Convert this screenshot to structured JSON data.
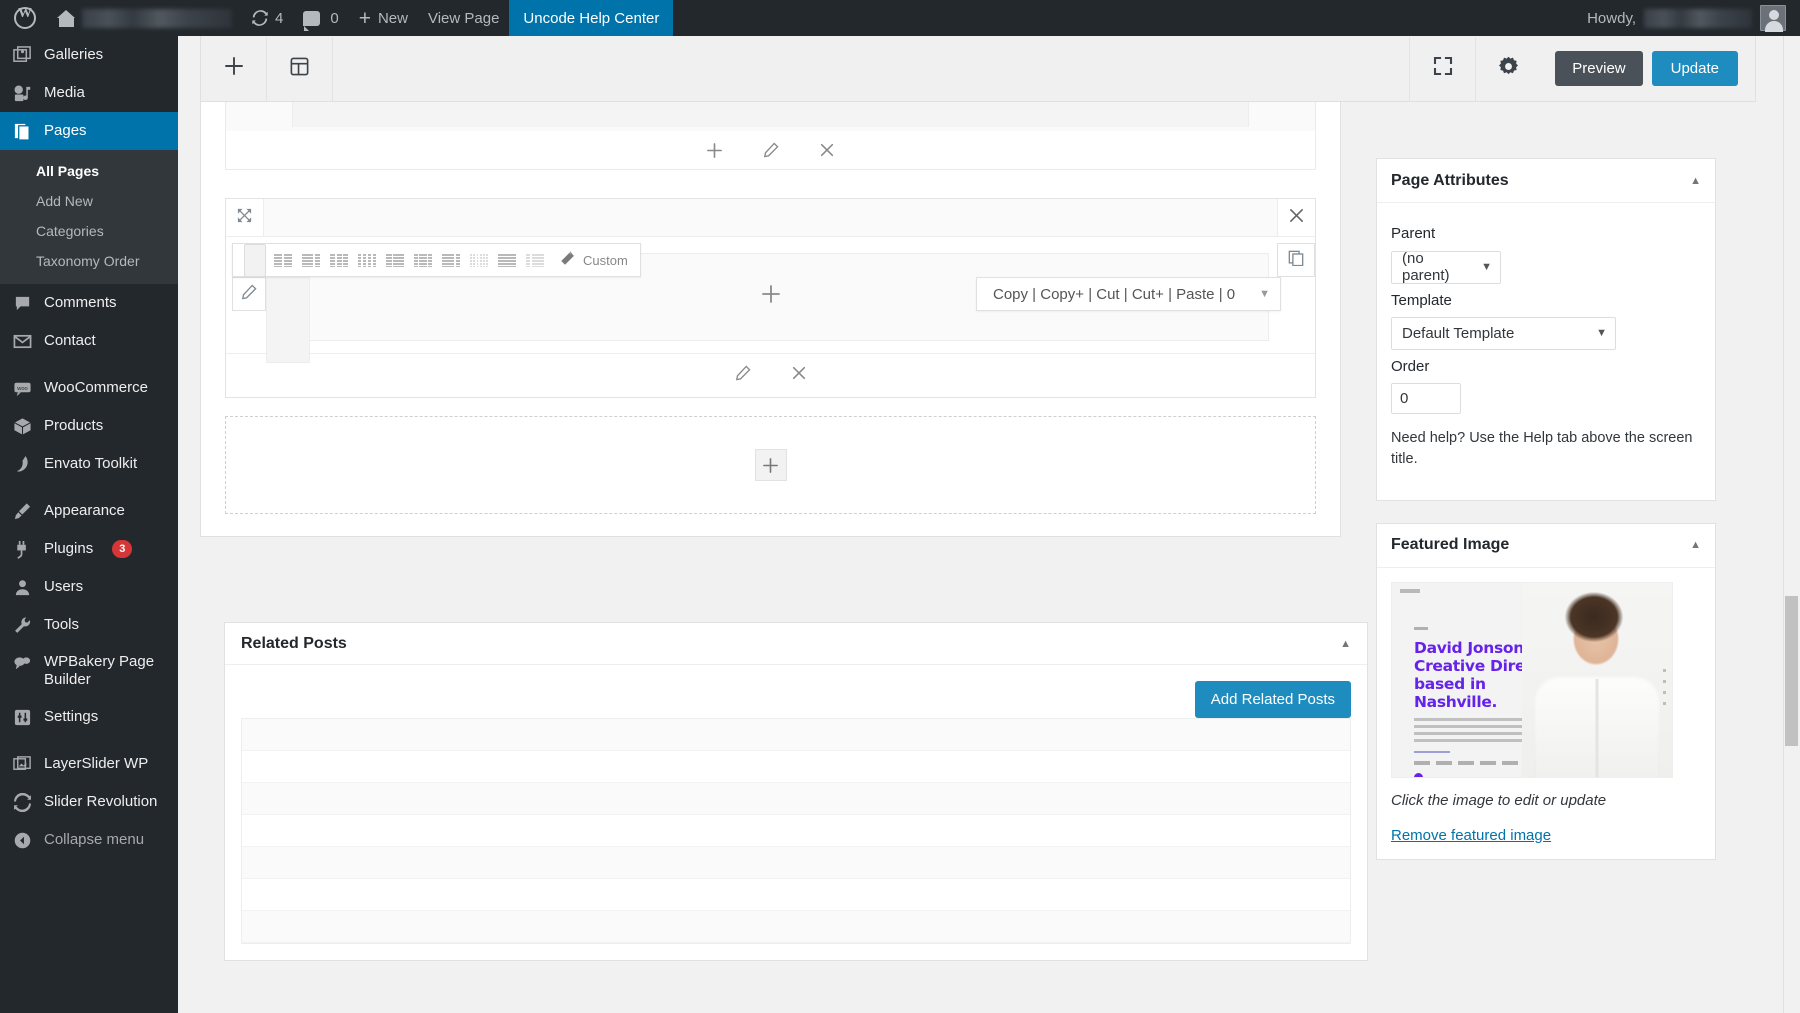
{
  "adminbar": {
    "site_name_redacted": "",
    "updates_count": "4",
    "comments_count": "0",
    "new_label": "New",
    "view_page_label": "View Page",
    "help_center_label": "Uncode Help Center",
    "howdy_label": "Howdy,",
    "username_redacted": ""
  },
  "sidebar": {
    "items": [
      {
        "label": "Galleries",
        "icon": "galleries-icon",
        "current": false
      },
      {
        "label": "Media",
        "icon": "media-icon",
        "current": false
      },
      {
        "label": "Pages",
        "icon": "pages-icon",
        "current": true
      },
      {
        "label": "Comments",
        "icon": "comments-icon",
        "current": false
      },
      {
        "label": "Contact",
        "icon": "contact-icon",
        "current": false
      },
      {
        "label": "WooCommerce",
        "icon": "woocommerce-icon",
        "current": false
      },
      {
        "label": "Products",
        "icon": "products-icon",
        "current": false
      },
      {
        "label": "Envato Toolkit",
        "icon": "envato-icon",
        "current": false
      },
      {
        "label": "Appearance",
        "icon": "appearance-icon",
        "current": false
      },
      {
        "label": "Plugins",
        "icon": "plugins-icon",
        "current": false,
        "badge": "3"
      },
      {
        "label": "Users",
        "icon": "users-icon",
        "current": false
      },
      {
        "label": "Tools",
        "icon": "tools-icon",
        "current": false
      },
      {
        "label": "WPBakery Page Builder",
        "icon": "wpbakery-icon",
        "current": false
      },
      {
        "label": "Settings",
        "icon": "settings-icon",
        "current": false
      },
      {
        "label": "LayerSlider WP",
        "icon": "layerslider-icon",
        "current": false
      },
      {
        "label": "Slider Revolution",
        "icon": "sliderrevolution-icon",
        "current": false
      },
      {
        "label": "Collapse menu",
        "icon": "collapse-icon",
        "current": false
      }
    ],
    "pages_submenu": [
      {
        "label": "All Pages",
        "current": true
      },
      {
        "label": "Add New",
        "current": false
      },
      {
        "label": "Categories",
        "current": false
      },
      {
        "label": "Taxonomy Order",
        "current": false
      }
    ]
  },
  "editor_toolbar": {
    "add_element_icon": "plus-icon",
    "templates_icon": "layout-templates-icon",
    "fullscreen_icon": "fullscreen-icon",
    "settings_icon": "gear-icon",
    "preview_label": "Preview",
    "update_label": "Update"
  },
  "layout_bar": {
    "patterns": [
      {
        "name": "1-column",
        "cols": [
          12
        ],
        "selected": true,
        "light": false
      },
      {
        "name": "2-columns",
        "cols": [
          6,
          6
        ],
        "selected": false,
        "light": false
      },
      {
        "name": "2-columns-wide-left",
        "cols": [
          8,
          4
        ],
        "selected": false,
        "light": false
      },
      {
        "name": "3-columns",
        "cols": [
          4,
          4,
          4
        ],
        "selected": false,
        "light": false
      },
      {
        "name": "4-columns",
        "cols": [
          3,
          3,
          3,
          3
        ],
        "selected": false,
        "light": false
      },
      {
        "name": "2-columns-narrow-left",
        "cols": [
          4,
          8
        ],
        "selected": false,
        "light": false
      },
      {
        "name": "3-columns-uneven",
        "cols": [
          3,
          6,
          3
        ],
        "selected": false,
        "light": false
      },
      {
        "name": "2-columns-wide-left-b",
        "cols": [
          9,
          3
        ],
        "selected": false,
        "light": false
      },
      {
        "name": "6-columns",
        "cols": [
          2,
          2,
          2,
          2,
          2,
          2
        ],
        "selected": false,
        "light": true
      },
      {
        "name": "1-column-b",
        "cols": [
          12
        ],
        "selected": false,
        "light": false
      },
      {
        "name": "2-columns-narrow",
        "cols": [
          3,
          9
        ],
        "selected": false,
        "light": true
      }
    ],
    "custom_label": "Custom",
    "custom_icon": "magic-wand-icon"
  },
  "clipboard_bar": {
    "label": "Copy | Copy+ | Cut | Cut+ | Paste | 0",
    "caret_icon": "chevron-down-icon"
  },
  "row_controls": {
    "add_icon": "plus-icon",
    "edit_icon": "pencil-icon",
    "delete_icon": "close-icon",
    "expand_icon": "expand-arrows-icon",
    "duplicate_icon": "duplicate-icon"
  },
  "related_posts": {
    "title": "Related Posts",
    "toggle_icon": "chevron-up-icon",
    "add_button_label": "Add Related Posts"
  },
  "page_attributes": {
    "title": "Page Attributes",
    "toggle_icon": "chevron-up-icon",
    "parent_label": "Parent",
    "parent_value": "(no parent)",
    "template_label": "Template",
    "template_value": "Default Template",
    "order_label": "Order",
    "order_value": "0",
    "help_text": "Need help? Use the Help tab above the screen title."
  },
  "featured_image": {
    "title": "Featured Image",
    "toggle_icon": "chevron-up-icon",
    "thumbnail_headline": "David Jonson is a Creative Director based in Nashville.",
    "caption": "Click the image to edit or update",
    "remove_link": "Remove featured image",
    "accent_color": "#6522e8"
  },
  "colors": {
    "admin_blue": "#0073aa",
    "button_blue": "#1e8cbe",
    "badge_red": "#d63638",
    "admin_dark": "#23282d"
  }
}
